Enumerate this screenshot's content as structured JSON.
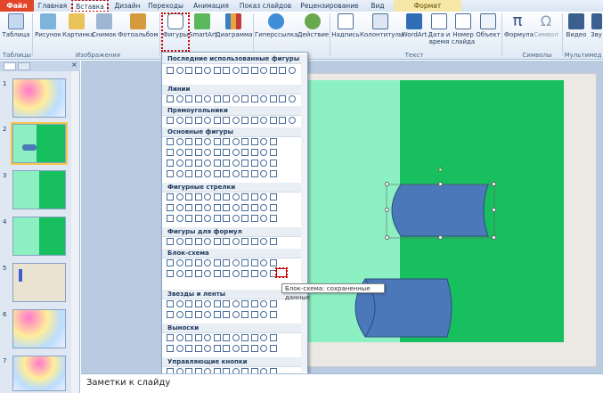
{
  "tabs": [
    "Файл",
    "Главная",
    "Вставка",
    "Дизайн",
    "Переходы",
    "Анимация",
    "Показ слайдов",
    "Рецензирование",
    "Вид",
    "Формат"
  ],
  "ribbon": {
    "buttons": [
      "Таблица",
      "Рисунок",
      "Картинка",
      "Снимок",
      "Фотоальбом",
      "Фигуры",
      "SmartArt",
      "Диаграмма",
      "Гиперссылка",
      "Действие",
      "Надпись",
      "Колонтитулы",
      "WordArt",
      "Дата и время",
      "Номер слайда",
      "Объект",
      "Формула",
      "Символ",
      "Видео",
      "Зву"
    ],
    "groups": [
      "Таблицы",
      "Изображения",
      "Текст",
      "Символы",
      "Мультимед"
    ]
  },
  "shapes_menu": {
    "categories": [
      "Последние использованные фигуры",
      "Линии",
      "Прямоугольники",
      "Основные фигуры",
      "Фигурные стрелки",
      "Фигуры для формул",
      "Блок-схема",
      "Звезды и ленты",
      "Выноски",
      "Управляющие кнопки"
    ],
    "tooltip": "Блок-схема: сохраненные данные"
  },
  "slides": [
    "1",
    "2",
    "3",
    "4",
    "5",
    "6",
    "7"
  ],
  "notes_placeholder": "Заметки к слайду",
  "colors": {
    "accent_red": "#c00000",
    "slide_green": "#18bf5e",
    "slide_mint": "#8cf0c3",
    "shape_blue": "#4a78b8"
  }
}
